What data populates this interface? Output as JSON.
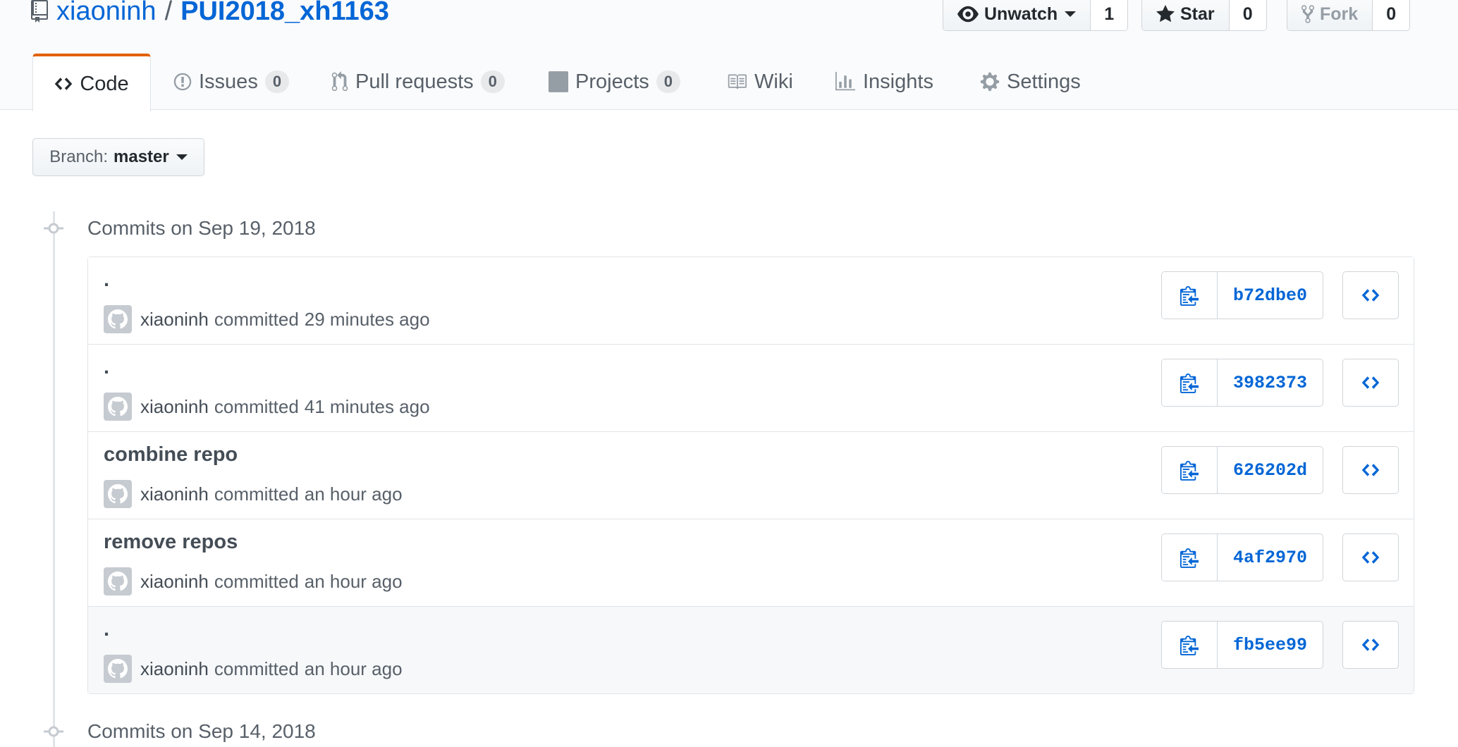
{
  "repo": {
    "owner": "xiaoninh",
    "separator": "/",
    "name": "PUI2018_xh1163"
  },
  "actions": {
    "watch": {
      "label": "Unwatch",
      "count": "1"
    },
    "star": {
      "label": "Star",
      "count": "0"
    },
    "fork": {
      "label": "Fork",
      "count": "0"
    }
  },
  "tabs": [
    {
      "label": "Code",
      "counter": null
    },
    {
      "label": "Issues",
      "counter": "0"
    },
    {
      "label": "Pull requests",
      "counter": "0"
    },
    {
      "label": "Projects",
      "counter": "0"
    },
    {
      "label": "Wiki",
      "counter": null
    },
    {
      "label": "Insights",
      "counter": null
    },
    {
      "label": "Settings",
      "counter": null
    }
  ],
  "branch": {
    "prefix": "Branch:",
    "name": "master"
  },
  "groups": [
    {
      "label": "Commits on Sep 19, 2018",
      "commits": [
        {
          "message": ".",
          "author": "xiaoninh",
          "verb": "committed",
          "when": "29 minutes ago",
          "sha": "b72dbe0"
        },
        {
          "message": ".",
          "author": "xiaoninh",
          "verb": "committed",
          "when": "41 minutes ago",
          "sha": "3982373"
        },
        {
          "message": "combine repo",
          "author": "xiaoninh",
          "verb": "committed",
          "when": "an hour ago",
          "sha": "626202d"
        },
        {
          "message": "remove repos",
          "author": "xiaoninh",
          "verb": "committed",
          "when": "an hour ago",
          "sha": "4af2970"
        },
        {
          "message": ".",
          "author": "xiaoninh",
          "verb": "committed",
          "when": "an hour ago",
          "sha": "fb5ee99"
        }
      ]
    },
    {
      "label": "Commits on Sep 14, 2018",
      "commits": []
    }
  ],
  "colors": {
    "link": "#0366d6",
    "selected_tab_accent": "#e36209",
    "muted_text": "#586069",
    "border": "#e1e4e8"
  },
  "icons": {
    "repo": "repo-book-icon",
    "watch": "eye-icon",
    "star": "star-icon",
    "fork": "fork-icon",
    "code": "code-icon",
    "issues": "issue-opened-icon",
    "pull_requests": "git-pull-request-icon",
    "projects": "project-icon",
    "wiki": "book-icon",
    "insights": "graph-icon",
    "settings": "gear-icon",
    "copy": "clippy-icon",
    "browse": "code-icon"
  }
}
